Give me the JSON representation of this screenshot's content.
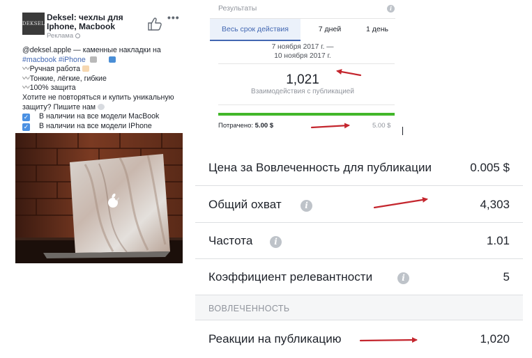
{
  "post": {
    "avatar_text": "DEKSEL",
    "page_name": "Deksel: чехлы для Iphone, Macbook",
    "sponsored": "Реклама",
    "more": "•••",
    "lines": {
      "l1": "@deksel.apple — каменные накладки на",
      "tag1": "#macbook",
      "tag2": "#iPhone",
      "l3": "Ручная работа",
      "l4": "Тонкие, лёгкие, гибкие",
      "l5": "100% защита",
      "l6": "Хотите не повторяться и купить уникальную",
      "l7": "защиту? Пишите нам",
      "check1": "В наличии на все модели MacBook",
      "check2": "В наличии на все модели IPhone"
    },
    "photo_icon": "apple-logo-icon"
  },
  "results": {
    "title": "Результаты",
    "tabs": [
      "Весь срок действия",
      "7 дней",
      "1 день"
    ],
    "active_tab": 0,
    "date_line1": "7 ноября 2017 г. —",
    "date_line2": "10 ноября 2017 г.",
    "engagements": "1,021",
    "engagements_label": "Взаимодействия с публикацией",
    "spent_label": "Потрачено:",
    "spent_value": "5.00 $",
    "budget": "5.00 $",
    "budget_progress": 1.0
  },
  "metrics": [
    {
      "label": "Цена за Вовлеченность для публикации",
      "value": "0.005 $",
      "info": false
    },
    {
      "label": "Общий охват",
      "value": "4,303",
      "info": true
    },
    {
      "label": "Частота",
      "value": "1.01",
      "info": true
    },
    {
      "label": "Коэффициент релевантности",
      "value": "5",
      "info": true
    }
  ],
  "section": {
    "title": "ВОВЛЕЧЕННОСТЬ"
  },
  "reactions": {
    "label": "Реакции на публикацию",
    "value": "1,020"
  },
  "colors": {
    "annotation_arrow": "#c4262e",
    "fb_blue": "#4267b2",
    "progress_green": "#42b72a",
    "checkbox_blue": "#4a90e2"
  }
}
